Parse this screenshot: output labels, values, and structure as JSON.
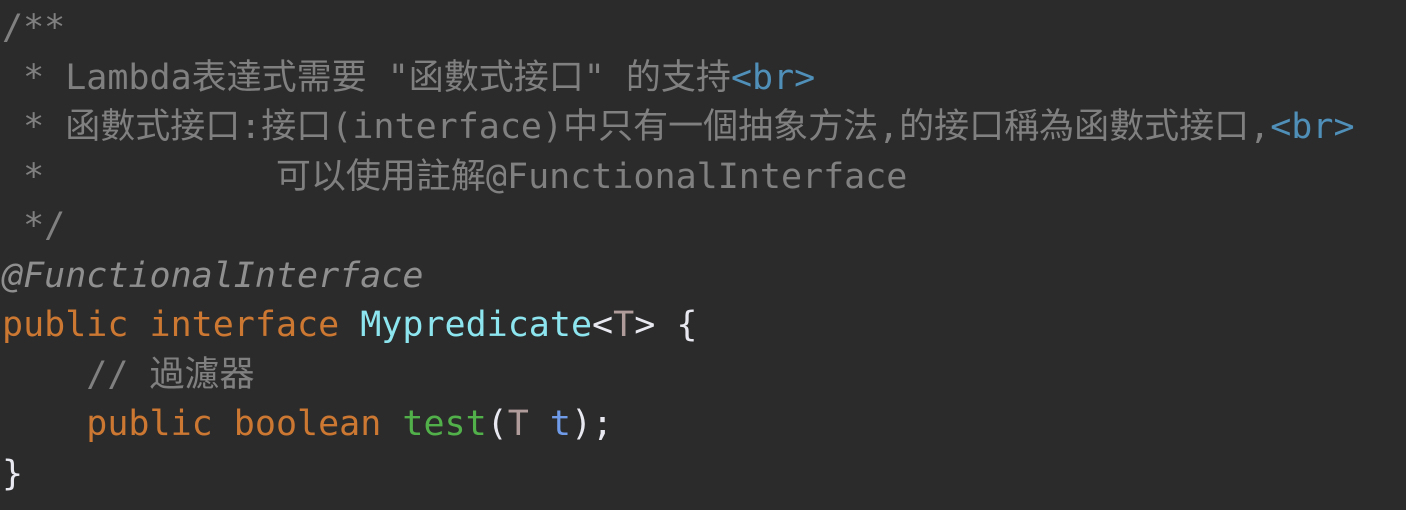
{
  "code_lines": [
    [
      {
        "t": "/**",
        "c": "comment"
      }
    ],
    [
      {
        "t": " * Lambda表達式需要 \"函數式接口\" 的支持",
        "c": "comment"
      },
      {
        "t": "<br>",
        "c": "tag"
      }
    ],
    [
      {
        "t": " * 函數式接口:接口(interface)中只有一個抽象方法,的接口稱為函數式接口,",
        "c": "comment"
      },
      {
        "t": "<br>",
        "c": "tag"
      }
    ],
    [
      {
        "t": " *           可以使用註解@FunctionalInterface",
        "c": "comment"
      }
    ],
    [
      {
        "t": " */",
        "c": "comment"
      }
    ],
    [
      {
        "t": "@FunctionalInterface",
        "c": "annot"
      }
    ],
    [
      {
        "t": "public ",
        "c": "kw"
      },
      {
        "t": "interface ",
        "c": "kw"
      },
      {
        "t": "Mypredicate",
        "c": "cls"
      },
      {
        "t": "<",
        "c": "punct"
      },
      {
        "t": "T",
        "c": "tparam"
      },
      {
        "t": "> {",
        "c": "punct"
      }
    ],
    [
      {
        "t": "    // 過濾器",
        "c": "comment"
      }
    ],
    [
      {
        "t": "    public ",
        "c": "kw"
      },
      {
        "t": "boolean ",
        "c": "kw"
      },
      {
        "t": "test",
        "c": "method"
      },
      {
        "t": "(",
        "c": "punct"
      },
      {
        "t": "T ",
        "c": "tparam"
      },
      {
        "t": "t",
        "c": "param"
      },
      {
        "t": ");",
        "c": "punct"
      }
    ],
    [
      {
        "t": "}",
        "c": "punct"
      }
    ]
  ]
}
